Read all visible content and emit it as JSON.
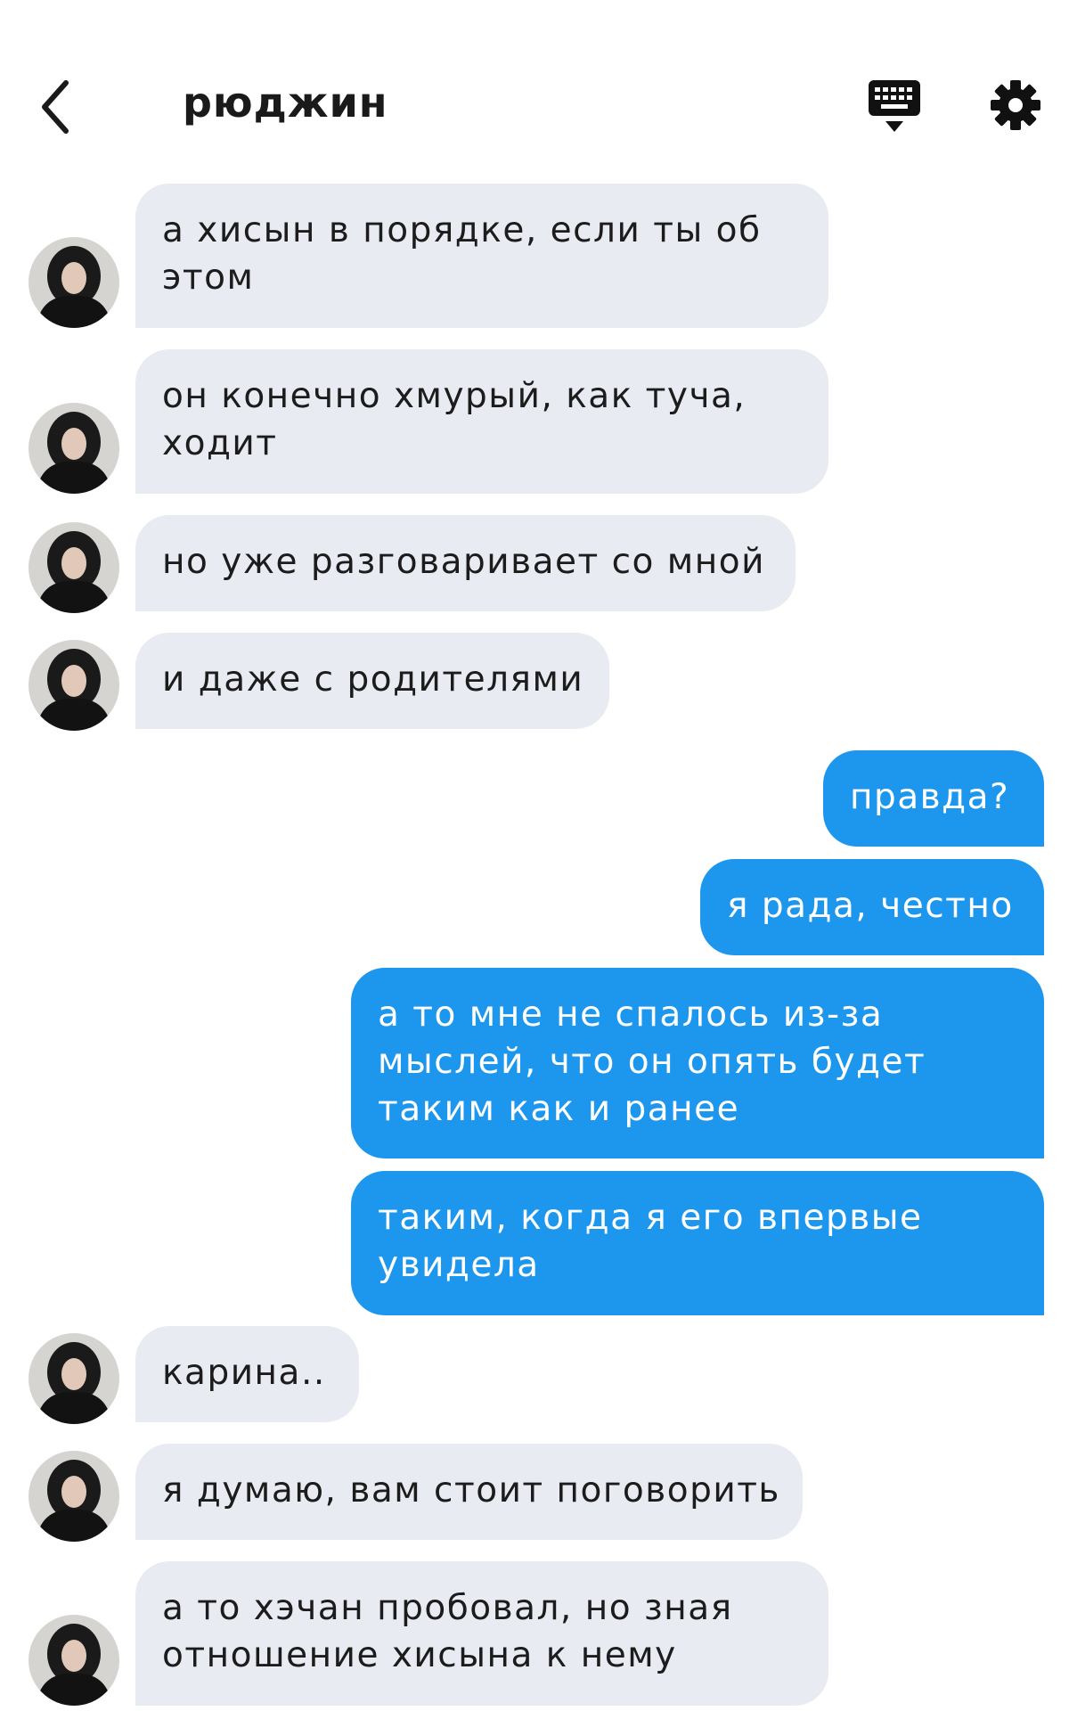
{
  "header": {
    "title": "рюджин",
    "back_icon": "chevron-left-icon",
    "keyboard_icon": "keyboard-icon",
    "settings_icon": "gear-icon"
  },
  "colors": {
    "incoming_bubble": "#e9ebf2",
    "outgoing_bubble": "#1d97ed",
    "text": "#1c1c1c"
  },
  "messages": [
    {
      "side": "in",
      "text": "а хисын в порядке, если ты об\nэтом"
    },
    {
      "side": "in",
      "text": "он конечно хмурый, как туча,\nходит"
    },
    {
      "side": "in",
      "text": "но уже разговаривает со мной"
    },
    {
      "side": "in",
      "text": "и даже с родителями"
    },
    {
      "side": "out",
      "text": "правда?"
    },
    {
      "side": "out",
      "text": "я рада, честно"
    },
    {
      "side": "out",
      "text": "а то мне не спалось из-за\nмыслей, что он опять будет\nтаким как и ранее"
    },
    {
      "side": "out",
      "text": "таким, когда я его впервые\nувидела"
    },
    {
      "side": "in",
      "text": "карина.."
    },
    {
      "side": "in",
      "text": "я думаю, вам стоит поговорить"
    },
    {
      "side": "in",
      "text": "а то хэчан пробовал, но зная\nотношение хисына к нему"
    }
  ]
}
